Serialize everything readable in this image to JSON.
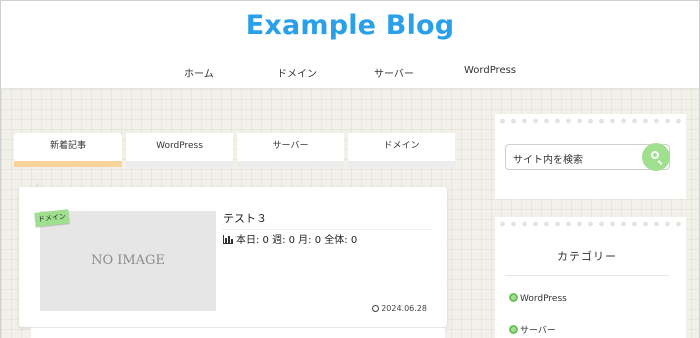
{
  "header": {
    "site_title": "Example Blog",
    "nav": [
      "ホーム",
      "ドメイン",
      "サーバー",
      "WordPress"
    ]
  },
  "tabs": [
    {
      "label": "新着記事",
      "active": true
    },
    {
      "label": "WordPress",
      "active": false
    },
    {
      "label": "サーバー",
      "active": false
    },
    {
      "label": "ドメイン",
      "active": false
    }
  ],
  "post": {
    "category": "ドメイン",
    "thumbnail_text": "NO IMAGE",
    "title": "テスト３",
    "views": "本日: 0  週: 0  月: 0  全体: 0",
    "date": "2024.06.28"
  },
  "sidebar": {
    "search_placeholder": "サイト内を検索",
    "categories_heading": "カテゴリー",
    "categories": [
      "WordPress",
      "サーバー"
    ]
  },
  "colors": {
    "brand": "#2aa0ea",
    "accent_green": "#9fe08f",
    "active_tab": "#f8d49b"
  },
  "icons": [
    "bar-chart-icon",
    "clock-icon",
    "search-icon",
    "circle-bullet-icon"
  ]
}
